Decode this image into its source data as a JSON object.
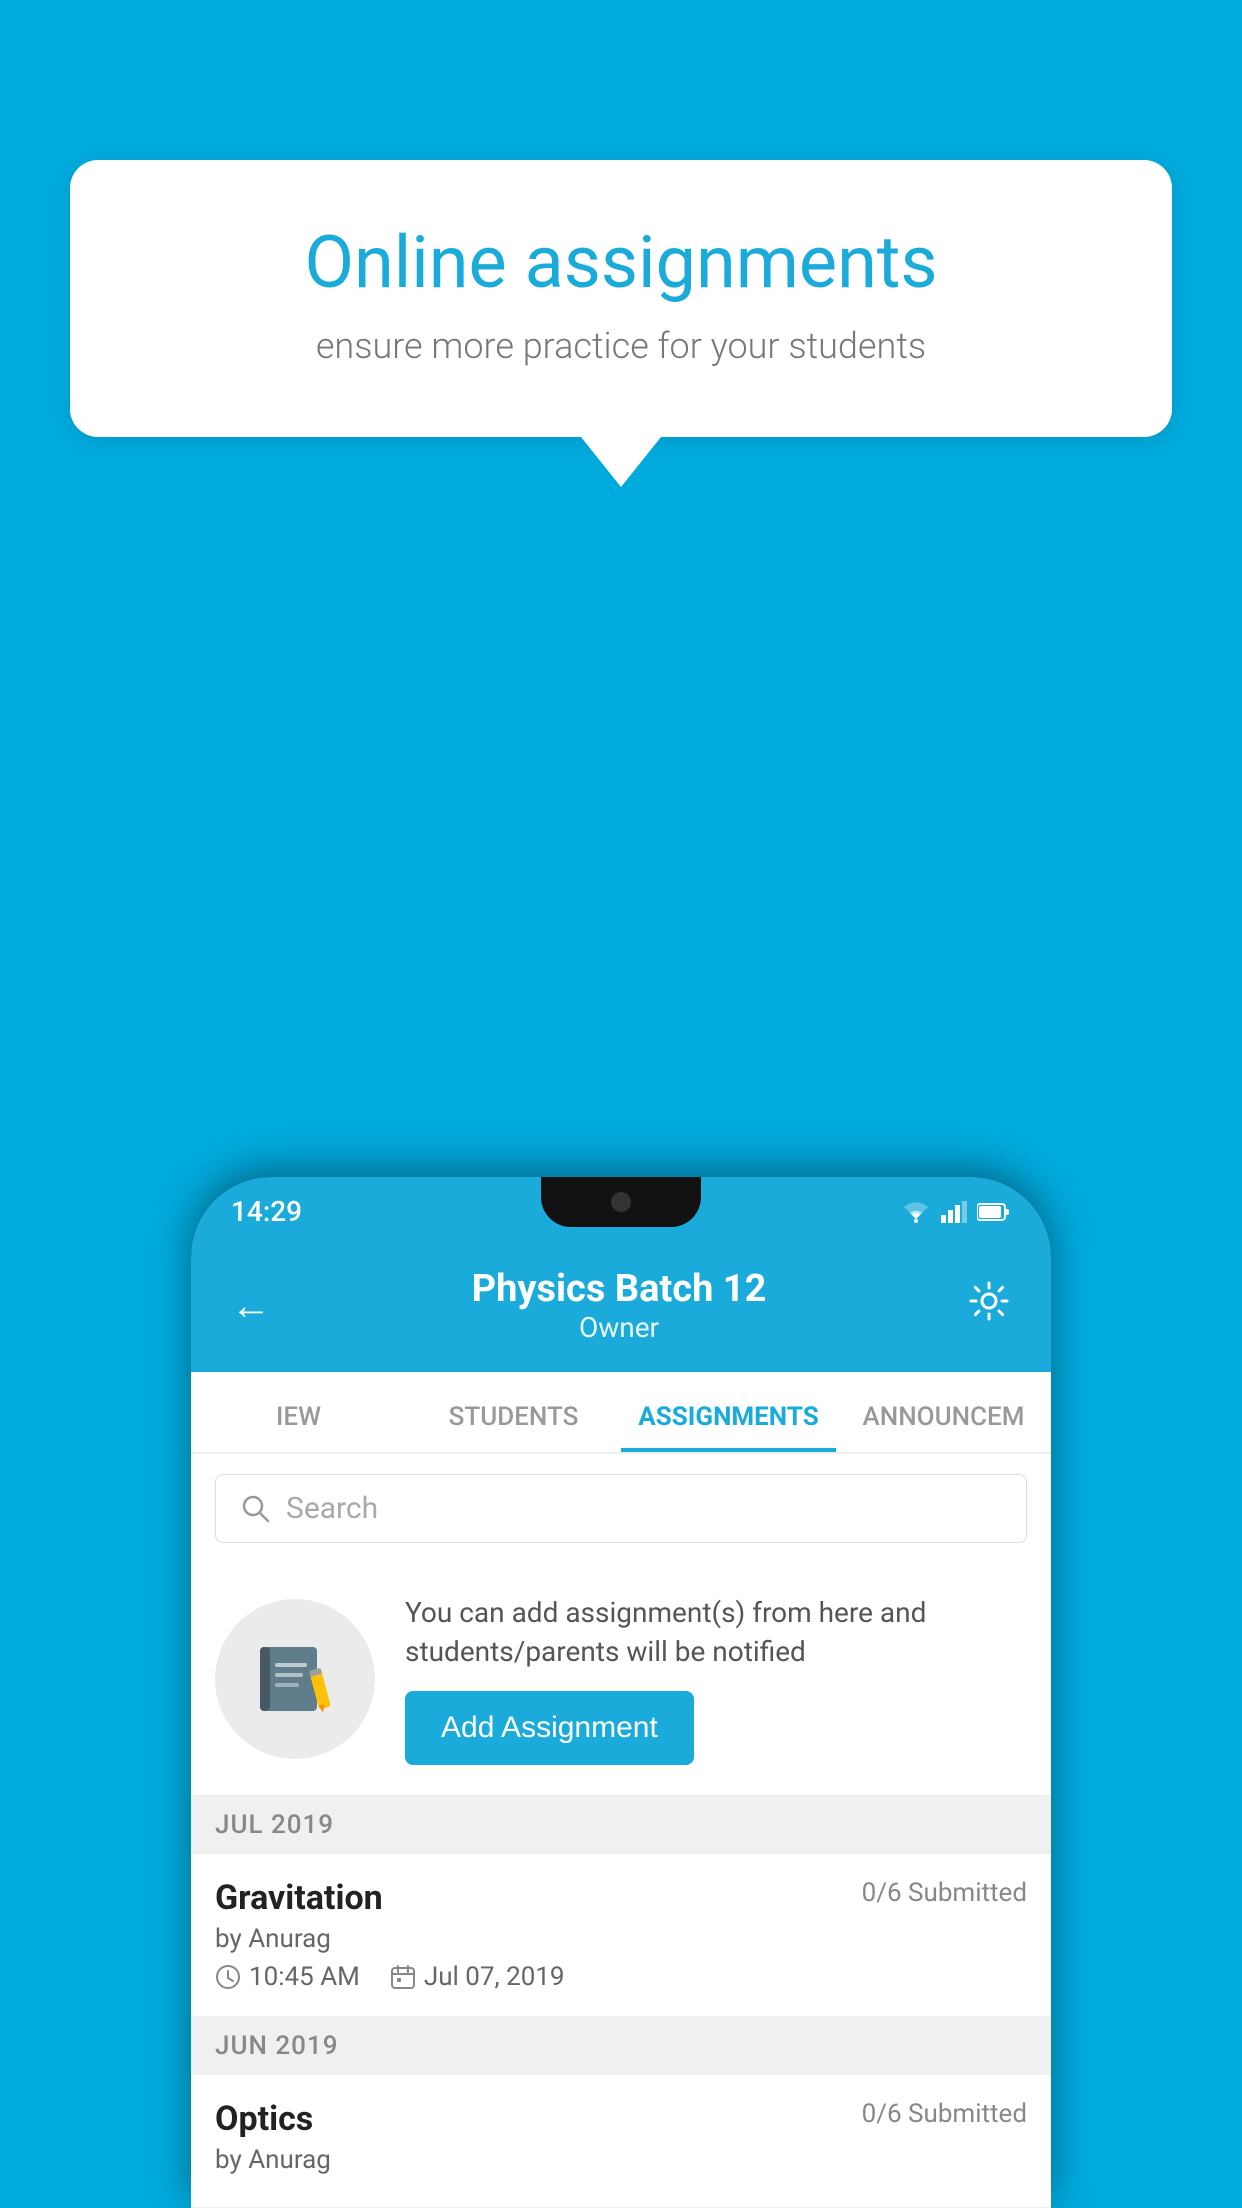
{
  "background_color": "#00AADD",
  "speech_bubble": {
    "title": "Online assignments",
    "subtitle": "ensure more practice for your students"
  },
  "status_bar": {
    "time": "14:29"
  },
  "app_header": {
    "title": "Physics Batch 12",
    "subtitle": "Owner",
    "back_label": "←",
    "settings_label": "⚙"
  },
  "tabs": [
    {
      "label": "IEW",
      "active": false
    },
    {
      "label": "STUDENTS",
      "active": false
    },
    {
      "label": "ASSIGNMENTS",
      "active": true
    },
    {
      "label": "ANNOUNCEM",
      "active": false
    }
  ],
  "search": {
    "placeholder": "Search"
  },
  "promo": {
    "text": "You can add assignment(s) from here and students/parents will be notified",
    "button_label": "Add Assignment"
  },
  "sections": [
    {
      "header": "JUL 2019",
      "assignments": [
        {
          "title": "Gravitation",
          "submitted": "0/6 Submitted",
          "by": "by Anurag",
          "time": "10:45 AM",
          "date": "Jul 07, 2019"
        }
      ]
    },
    {
      "header": "JUN 2019",
      "assignments": [
        {
          "title": "Optics",
          "submitted": "0/6 Submitted",
          "by": "by Anurag",
          "time": "",
          "date": ""
        }
      ]
    }
  ]
}
